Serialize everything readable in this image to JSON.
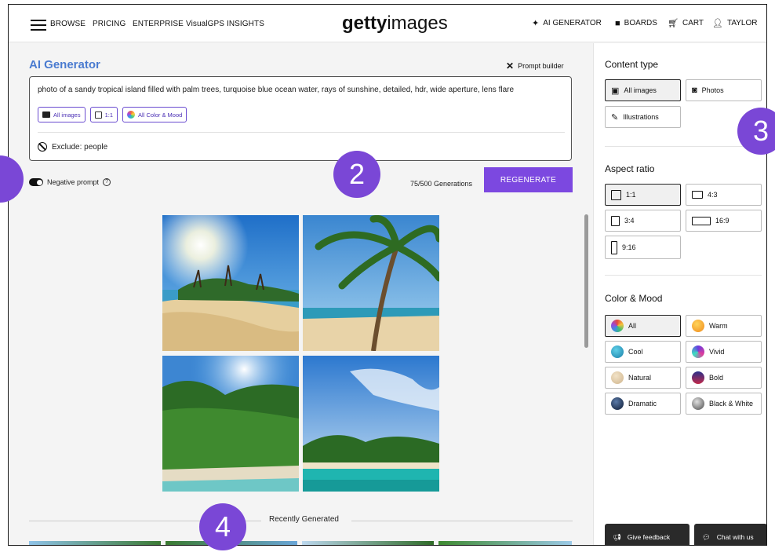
{
  "header": {
    "nav": [
      "BROWSE",
      "PRICING",
      "ENTERPRISE",
      "VisualGPS INSIGHTS"
    ],
    "logo_bold": "getty",
    "logo_light": "images",
    "right": {
      "ai_generator": "AI GENERATOR",
      "boards": "BOARDS",
      "cart": "CART",
      "user": "TAYLOR"
    }
  },
  "main": {
    "title": "AI Generator",
    "prompt_builder": "Prompt builder",
    "prompt": "photo of a sandy tropical island filled with palm trees, turquoise blue ocean water, rays of sunshine, detailed, hdr, wide aperture, lens flare",
    "chips": [
      "All images",
      "1:1",
      "All Color & Mood"
    ],
    "exclude": "Exclude: people",
    "negative_prompt": "Negative prompt",
    "generations": "75/500 Generations",
    "regenerate": "REGENERATE",
    "recently_generated": "Recently Generated"
  },
  "badges": [
    "2",
    "3",
    "4"
  ],
  "sidebar": {
    "content_type": {
      "title": "Content type",
      "options": [
        "All images",
        "Photos",
        "Illustrations"
      ],
      "selected": "All images"
    },
    "aspect_ratio": {
      "title": "Aspect ratio",
      "options": [
        "1:1",
        "4:3",
        "3:4",
        "16:9",
        "9:16"
      ],
      "selected": "1:1"
    },
    "color_mood": {
      "title": "Color & Mood",
      "options": [
        "All",
        "Warm",
        "Cool",
        "Vivid",
        "Natural",
        "Bold",
        "Dramatic",
        "Black & White"
      ],
      "selected": "All"
    },
    "feedback": "Give feedback",
    "chat": "Chat with us"
  },
  "colors": {
    "accent": "#7c48e0",
    "title_blue": "#4a7bd0",
    "badge": "#7a47d6"
  }
}
